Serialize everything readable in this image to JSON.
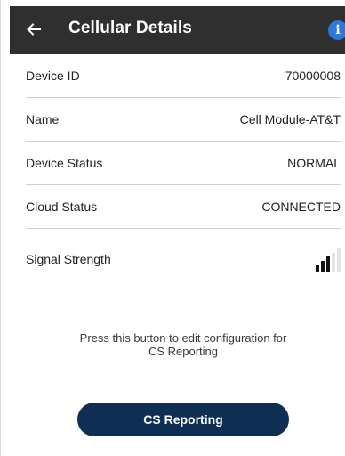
{
  "header": {
    "title": "Cellular Details",
    "back_icon": "arrow-left-icon",
    "info_icon": "info-icon",
    "info_glyph": "i",
    "bar_color": "#2f2f2f",
    "info_color": "#2f78d8"
  },
  "details": {
    "device_id": {
      "label": "Device ID",
      "value": "70000008"
    },
    "name": {
      "label": "Name",
      "value": "Cell Module-AT&T"
    },
    "device_status": {
      "label": "Device Status",
      "value": "NORMAL"
    },
    "cloud_status": {
      "label": "Cloud Status",
      "value": "CONNECTED"
    },
    "signal_strength": {
      "label": "Signal Strength",
      "icon": "signal-bars-icon",
      "level": 3,
      "max": 5
    }
  },
  "hint": {
    "line1": "Press this button to edit configuration for",
    "line2": "CS Reporting"
  },
  "cta": {
    "label": "CS Reporting",
    "color": "#0f2e53"
  }
}
